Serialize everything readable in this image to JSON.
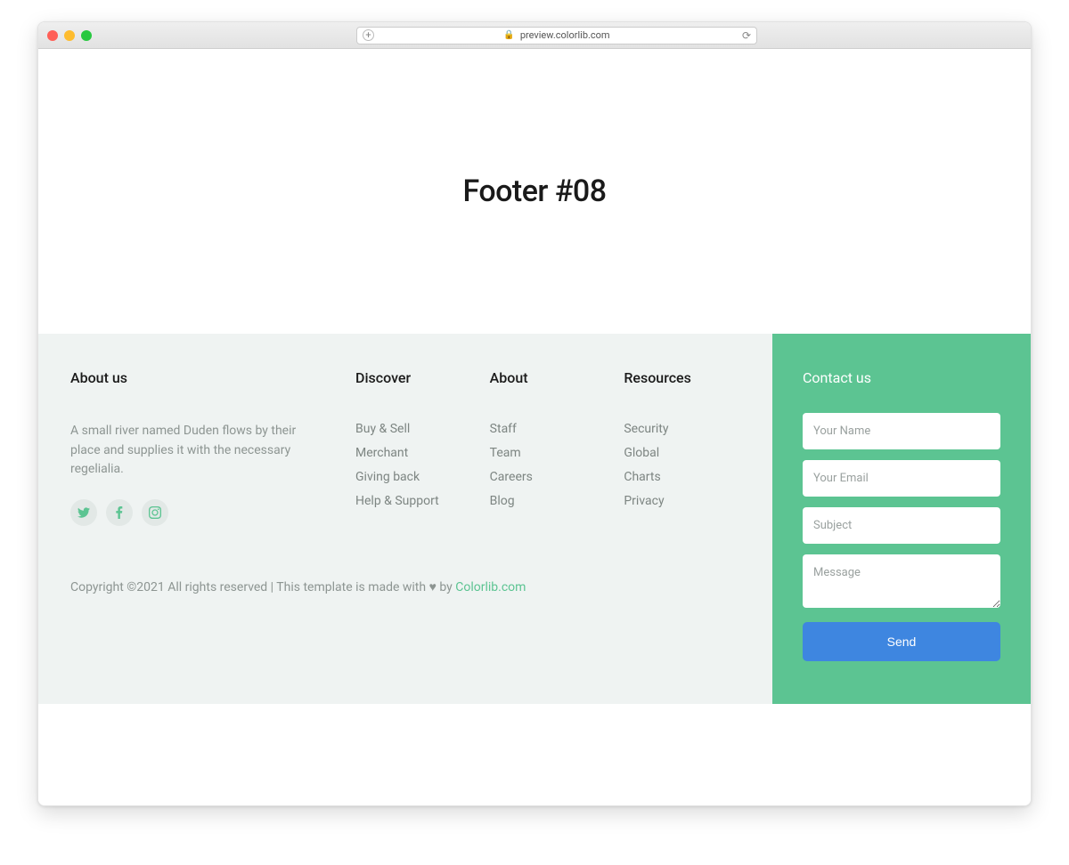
{
  "browser": {
    "url": "preview.colorlib.com"
  },
  "hero": {
    "title": "Footer #08"
  },
  "footer": {
    "about": {
      "heading": "About us",
      "text": "A small river named Duden flows by their place and supplies it with the necessary regelialia."
    },
    "discover": {
      "heading": "Discover",
      "links": [
        "Buy & Sell",
        "Merchant",
        "Giving back",
        "Help & Support"
      ]
    },
    "aboutCol": {
      "heading": "About",
      "links": [
        "Staff",
        "Team",
        "Careers",
        "Blog"
      ]
    },
    "resources": {
      "heading": "Resources",
      "links": [
        "Security",
        "Global",
        "Charts",
        "Privacy"
      ]
    },
    "copyright": {
      "pre": "Copyright ©2021 All rights reserved | This template is made with ",
      "mid": " by ",
      "link": "Colorlib.com"
    }
  },
  "contact": {
    "heading": "Contact us",
    "name_ph": "Your Name",
    "email_ph": "Your Email",
    "subject_ph": "Subject",
    "message_ph": "Message",
    "send": "Send"
  }
}
